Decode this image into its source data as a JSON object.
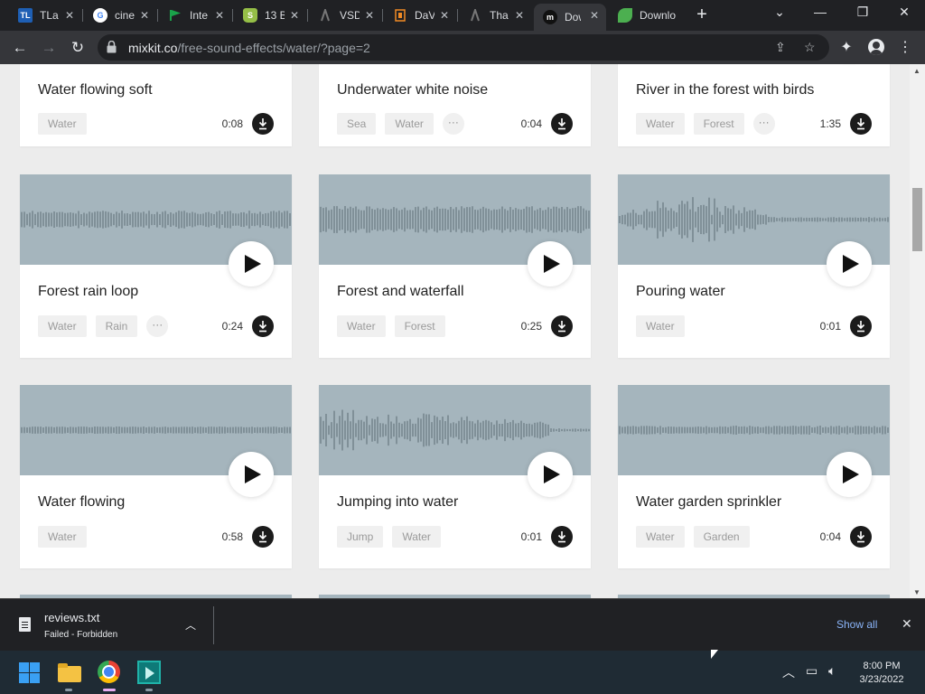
{
  "browser": {
    "tabs": [
      {
        "title": "TLa",
        "favicon": "TL",
        "favicon_color": "#1e5fb4",
        "active": false
      },
      {
        "title": "cine",
        "favicon": "G",
        "favicon_color": "#ffffff",
        "active": false
      },
      {
        "title": "Inte",
        "favicon": "flag",
        "favicon_color": "#1aa34a",
        "active": false
      },
      {
        "title": "13 B",
        "favicon": "shopify",
        "favicon_color": "#95bf47",
        "active": false
      },
      {
        "title": "VSD",
        "favicon": "vsd",
        "favicon_color": "#444444",
        "active": false
      },
      {
        "title": "DaV",
        "favicon": "dav",
        "favicon_color": "#f08a24",
        "active": false
      },
      {
        "title": "Tha",
        "favicon": "vsd",
        "favicon_color": "#444444",
        "active": false
      },
      {
        "title": "Dow",
        "favicon": "m",
        "favicon_color": "#111111",
        "active": true
      },
      {
        "title": "Downlo",
        "favicon": "leaf",
        "favicon_color": "#4caf50",
        "active": false
      }
    ],
    "new_tab": "+",
    "url_host": "mixkit.co",
    "url_path": "/free-sound-effects/water/?page=2"
  },
  "cards": [
    {
      "title": "Water flowing soft",
      "tags": [
        "Water"
      ],
      "more": false,
      "duration": "0:08",
      "wave": "none"
    },
    {
      "title": "Underwater white noise",
      "tags": [
        "Sea",
        "Water"
      ],
      "more": true,
      "duration": "0:04",
      "wave": "none"
    },
    {
      "title": "River in the forest with birds",
      "tags": [
        "Water",
        "Forest"
      ],
      "more": true,
      "duration": "1:35",
      "wave": "none"
    },
    {
      "title": "Forest rain loop",
      "tags": [
        "Water",
        "Rain"
      ],
      "more": true,
      "duration": "0:24",
      "wave": "steady"
    },
    {
      "title": "Forest and waterfall",
      "tags": [
        "Water",
        "Forest"
      ],
      "more": false,
      "duration": "0:25",
      "wave": "dense"
    },
    {
      "title": "Pouring water",
      "tags": [
        "Water"
      ],
      "more": false,
      "duration": "0:01",
      "wave": "burst"
    },
    {
      "title": "Water flowing",
      "tags": [
        "Water"
      ],
      "more": false,
      "duration": "0:58",
      "wave": "flat"
    },
    {
      "title": "Jumping into water",
      "tags": [
        "Jump",
        "Water"
      ],
      "more": false,
      "duration": "0:01",
      "wave": "jump"
    },
    {
      "title": "Water garden sprinkler",
      "tags": [
        "Water",
        "Garden"
      ],
      "more": false,
      "duration": "0:04",
      "wave": "thin"
    }
  ],
  "download_bar": {
    "filename": "reviews.txt",
    "status": "Failed - Forbidden",
    "show_all": "Show all"
  },
  "taskbar": {
    "time": "8:00 PM",
    "date": "3/23/2022"
  }
}
